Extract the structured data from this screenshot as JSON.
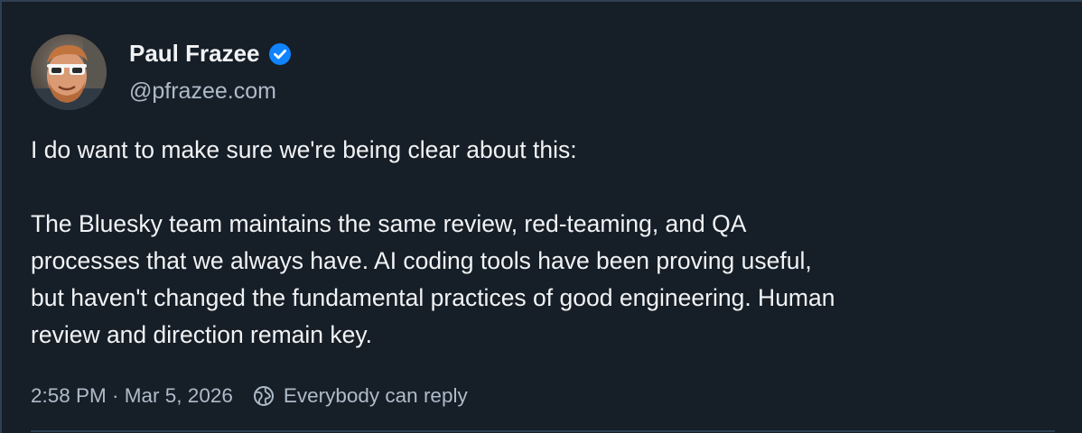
{
  "author": {
    "name": "Paul Frazee",
    "handle": "@pfrazee.com",
    "verified": true,
    "avatar_icon": "user-avatar"
  },
  "post": {
    "paragraphs": [
      [
        "I do want to make sure we're being clear about this:"
      ],
      [
        "The Bluesky team maintains the same review, red-teaming, and QA",
        "processes that we always have. AI coding tools have been proving useful,",
        "but haven't changed the fundamental practices of good engineering. Human",
        "review and direction remain key."
      ]
    ]
  },
  "meta": {
    "timestamp": "2:58 PM · Mar 5, 2026",
    "reply_setting": "Everybody can reply",
    "reply_icon": "globe-icon"
  },
  "colors": {
    "background": "#161e27",
    "text": "#f1f3f5",
    "muted": "#aebbc9",
    "verified": "#1083fe",
    "border": "#2e4052"
  }
}
